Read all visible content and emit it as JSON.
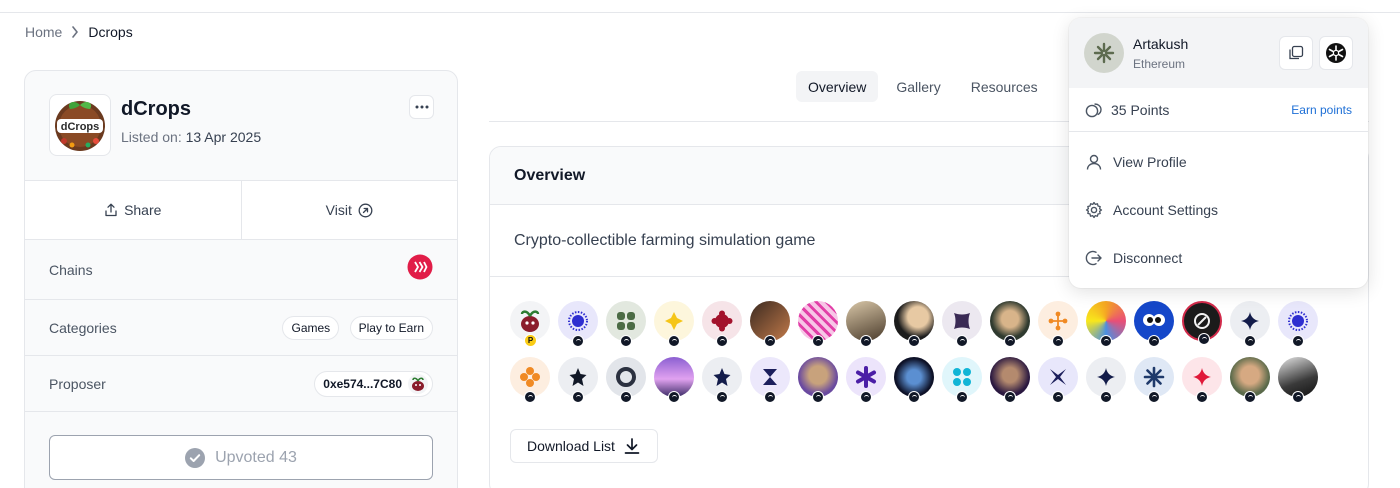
{
  "breadcrumb": {
    "home": "Home",
    "current": "Dcrops"
  },
  "project": {
    "name": "dCrops",
    "listed_label": "Listed on:",
    "listed_date": "13 Apr 2025",
    "logo_text": "dCrops",
    "share_label": "Share",
    "visit_label": "Visit",
    "chains_label": "Chains",
    "categories_label": "Categories",
    "categories": [
      "Games",
      "Play to Earn"
    ],
    "proposer_label": "Proposer",
    "proposer_address": "0xe574...7C80",
    "upvote_label": "Upvoted 43"
  },
  "tabs": [
    "Overview",
    "Gallery",
    "Resources"
  ],
  "overview": {
    "heading": "Overview",
    "description": "Crypto-collectible farming simulation game",
    "download_label": "Download List"
  },
  "user_menu": {
    "name": "Artakush",
    "chain": "Ethereum",
    "points": "35 Points",
    "earn_points": "Earn points",
    "items": [
      "View Profile",
      "Account Settings",
      "Disconnect"
    ]
  },
  "colors": {
    "accent_link": "#1d6fd6",
    "chain_badge": "#e11d48"
  },
  "avatars": {
    "row1": [
      "dcrops-mascot-avatar",
      "blue-burst-avatar",
      "green-blob-avatar",
      "yellow-cross-avatar",
      "crimson-flower-avatar",
      "portrait-avatar",
      "pink-pattern-avatar",
      "dog-avatar",
      "portrait-avatar",
      "purple-x-avatar",
      "portrait-avatar",
      "orange-dots-avatar",
      "colorful-art-avatar",
      "owl-avatar",
      "dark-abstract-avatar",
      "navy-star-avatar",
      "blue-burst-avatar"
    ],
    "row2": [
      "orange-flower-avatar",
      "black-star-avatar",
      "gray-ring-avatar",
      "purple-landscape-avatar",
      "navy-star-avatar",
      "hourglass-avatar",
      "portrait-avatar",
      "violet-asterisk-avatar",
      "dark-art-avatar",
      "cyan-dots-avatar",
      "portrait-avatar",
      "navy-x-avatar",
      "navy-star-avatar",
      "navy-burst-avatar",
      "red-star-avatar",
      "portrait-avatar",
      "bw-photo-avatar"
    ]
  }
}
